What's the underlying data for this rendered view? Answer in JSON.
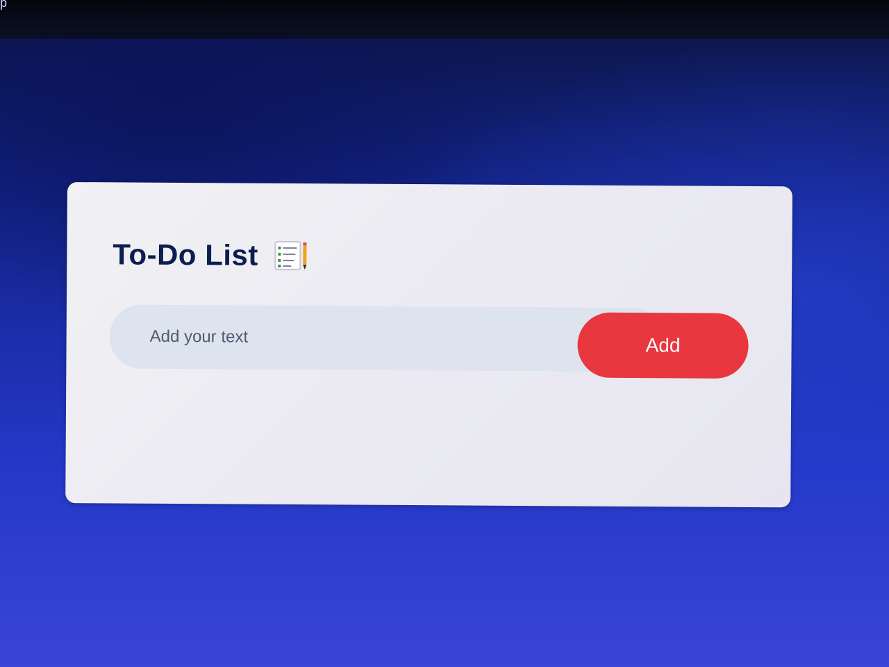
{
  "top_bar": {
    "partial_text": "p"
  },
  "todo_card": {
    "title": "To-Do List",
    "title_icon": "notepad-pencil-icon",
    "input": {
      "value": "",
      "placeholder": "Add your text"
    },
    "add_button_label": "Add"
  },
  "colors": {
    "accent_button": "#e8373f",
    "title_text": "#0b1e4f",
    "input_background": "#dde3ef",
    "card_background": "#f0f0f3",
    "page_background": "#2438c8"
  }
}
